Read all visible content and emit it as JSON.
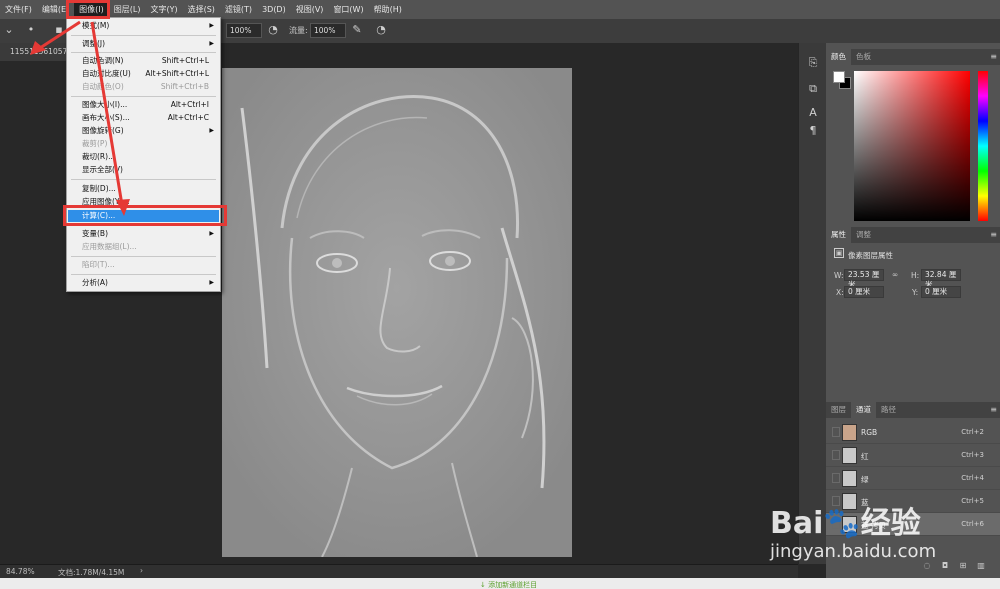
{
  "menubar": {
    "items": [
      "文件(F)",
      "编辑(E)",
      "图像(I)",
      "图层(L)",
      "文字(Y)",
      "选择(S)",
      "滤镜(T)",
      "3D(D)",
      "视图(V)",
      "窗口(W)",
      "帮助(H)"
    ]
  },
  "options": {
    "opacity": "100%",
    "flow_label": "流量:",
    "flow": "100%"
  },
  "document": {
    "tab_name": "11551156105773",
    "zoom": "84.78%",
    "doc_size": "文档:1.78M/4.15M",
    "status_arrow": "›"
  },
  "image_menu": {
    "items": [
      {
        "label": "模式(M)",
        "shortcut": "",
        "submenu": true,
        "disabled": false
      },
      {
        "label": "调整(J)",
        "shortcut": "",
        "submenu": true,
        "disabled": false
      },
      {
        "label": "自动色调(N)",
        "shortcut": "Shift+Ctrl+L",
        "submenu": false,
        "disabled": false
      },
      {
        "label": "自动对比度(U)",
        "shortcut": "Alt+Shift+Ctrl+L",
        "submenu": false,
        "disabled": false
      },
      {
        "label": "自动颜色(O)",
        "shortcut": "Shift+Ctrl+B",
        "submenu": false,
        "disabled": true
      },
      {
        "label": "图像大小(I)...",
        "shortcut": "Alt+Ctrl+I",
        "submenu": false,
        "disabled": false
      },
      {
        "label": "画布大小(S)...",
        "shortcut": "Alt+Ctrl+C",
        "submenu": false,
        "disabled": false
      },
      {
        "label": "图像旋转(G)",
        "shortcut": "",
        "submenu": true,
        "disabled": false
      },
      {
        "label": "裁剪(P)",
        "shortcut": "",
        "submenu": false,
        "disabled": true
      },
      {
        "label": "裁切(R)...",
        "shortcut": "",
        "submenu": false,
        "disabled": false
      },
      {
        "label": "显示全部(V)",
        "shortcut": "",
        "submenu": false,
        "disabled": false
      },
      {
        "label": "复制(D)...",
        "shortcut": "",
        "submenu": false,
        "disabled": false
      },
      {
        "label": "应用图像(Y)...",
        "shortcut": "",
        "submenu": false,
        "disabled": false
      },
      {
        "label": "计算(C)...",
        "shortcut": "",
        "submenu": false,
        "disabled": false,
        "highlighted": true
      },
      {
        "label": "变量(B)",
        "shortcut": "",
        "submenu": true,
        "disabled": false
      },
      {
        "label": "应用数据组(L)...",
        "shortcut": "",
        "submenu": false,
        "disabled": true
      },
      {
        "label": "陷印(T)...",
        "shortcut": "",
        "submenu": false,
        "disabled": true
      },
      {
        "label": "分析(A)",
        "shortcut": "",
        "submenu": true,
        "disabled": false
      }
    ]
  },
  "color_panel": {
    "tabs": [
      "颜色",
      "色板"
    ],
    "menu_glyph": "≡"
  },
  "properties_panel": {
    "tabs": [
      "属性",
      "调整"
    ],
    "title": "像素图层属性",
    "w_label": "W:",
    "w_value": "23.53 厘米",
    "h_label": "H:",
    "h_value": "32.84 厘米",
    "x_label": "X:",
    "x_value": "0 厘米",
    "y_label": "Y:",
    "y_value": "0 厘米",
    "link_glyph": "∞"
  },
  "channels_panel": {
    "tabs": [
      "图层",
      "通道",
      "路径"
    ],
    "channels": [
      {
        "name": "RGB",
        "shortcut": "Ctrl+2"
      },
      {
        "name": "红",
        "shortcut": "Ctrl+3"
      },
      {
        "name": "绿",
        "shortcut": "Ctrl+4"
      },
      {
        "name": "蓝",
        "shortcut": "Ctrl+5"
      },
      {
        "name": "蓝 拷贝",
        "shortcut": "Ctrl+6"
      }
    ]
  },
  "bottom_strip": {
    "text": "↓ 添加新通道栏目"
  },
  "watermark": {
    "logo": "Bai🐾经验",
    "url": "jingyan.baidu.com"
  }
}
